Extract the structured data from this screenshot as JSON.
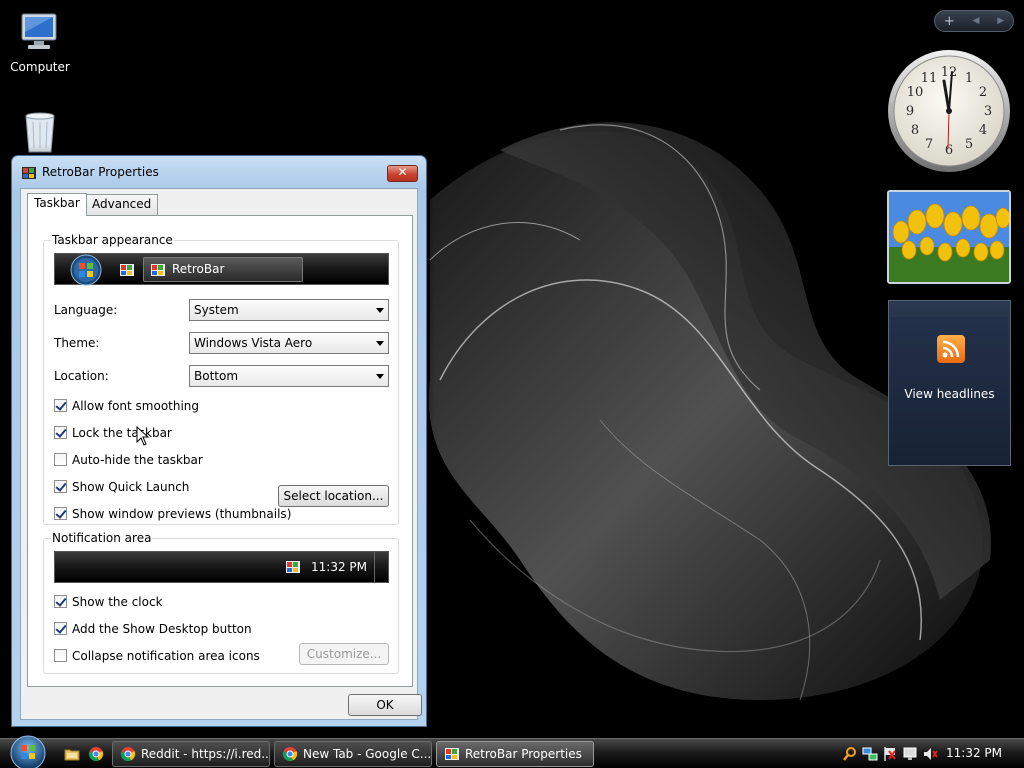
{
  "desktop": {
    "icons": [
      {
        "label": "Computer",
        "icon": "computer-icon"
      },
      {
        "label": "",
        "icon": "recycle-bin-icon"
      }
    ]
  },
  "gadgets": {
    "toolbar": {
      "add": "+",
      "prev": "◀",
      "next": "▶"
    },
    "feed": {
      "label": "View headlines",
      "icon": "rss-feed-icon"
    }
  },
  "window": {
    "title": "RetroBar Properties",
    "close_label": "✕",
    "tabs": [
      {
        "label": "Taskbar",
        "selected": true
      },
      {
        "label": "Advanced",
        "selected": false
      }
    ],
    "appearance": {
      "group_title": "Taskbar appearance",
      "preview_task_label": "RetroBar",
      "fields": [
        {
          "label": "Language:",
          "value": "System"
        },
        {
          "label": "Theme:",
          "value": "Windows Vista Aero"
        },
        {
          "label": "Location:",
          "value": "Bottom"
        }
      ],
      "checks": [
        {
          "label": "Allow font smoothing",
          "checked": true
        },
        {
          "label": "Lock the taskbar",
          "checked": true
        },
        {
          "label": "Auto-hide the taskbar",
          "checked": false
        },
        {
          "label": "Show Quick Launch",
          "checked": true
        },
        {
          "label": "Show window previews (thumbnails)",
          "checked": true
        }
      ],
      "select_location_label": "Select location..."
    },
    "notification": {
      "group_title": "Notification area",
      "preview_time": "11:32 PM",
      "checks": [
        {
          "label": "Show the clock",
          "checked": true
        },
        {
          "label": "Add the Show Desktop button",
          "checked": true
        },
        {
          "label": "Collapse notification area icons",
          "checked": false
        }
      ],
      "customize_label": "Customize..."
    },
    "ok_label": "OK"
  },
  "taskbar": {
    "tasks": [
      {
        "label": "Reddit - https://i.red...",
        "icon": "chrome-icon",
        "active": false
      },
      {
        "label": "New Tab - Google C...",
        "icon": "chrome-icon",
        "active": false
      },
      {
        "label": "RetroBar Properties",
        "icon": "retrobar-icon",
        "active": true
      }
    ],
    "clock": "11:32 PM"
  },
  "colors": {
    "accent": "#1e3d7a",
    "close": "#c7432e",
    "tray_bg": "#000000"
  }
}
